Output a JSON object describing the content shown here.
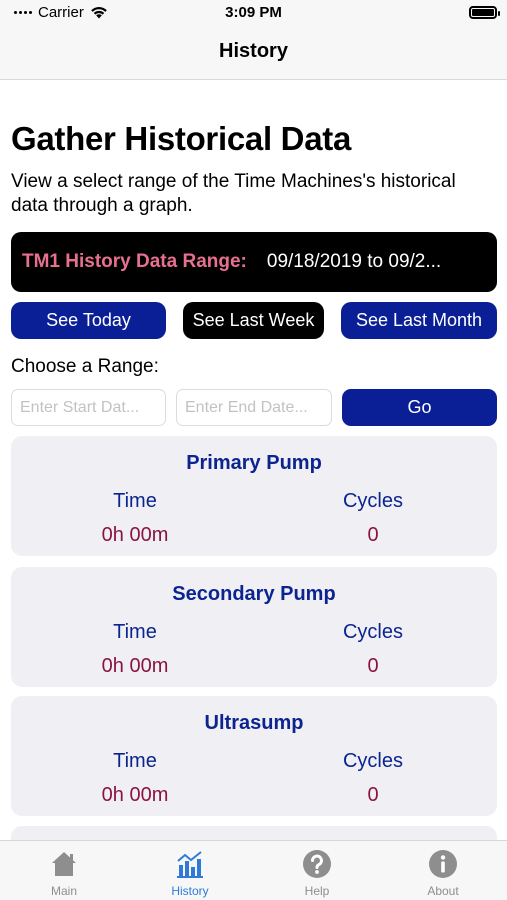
{
  "status_bar": {
    "carrier": "Carrier",
    "time": "3:09 PM"
  },
  "nav": {
    "title": "History"
  },
  "page": {
    "title": "Gather Historical Data",
    "description": "View a select range of the Time Machines's historical data through a graph."
  },
  "range_banner": {
    "label": "TM1 History Data Range:",
    "value": "09/18/2019 to 09/2..."
  },
  "quick_buttons": {
    "today": "See Today",
    "last_week": "See Last Week",
    "last_month": "See Last Month"
  },
  "choose_range": {
    "label": "Choose a Range:",
    "start_placeholder": "Enter Start Dat...",
    "end_placeholder": "Enter End Date...",
    "go_label": "Go"
  },
  "cards": [
    {
      "title": "Primary Pump",
      "time_label": "Time",
      "cycles_label": "Cycles",
      "time_value": "0h 00m",
      "cycles_value": "0"
    },
    {
      "title": "Secondary Pump",
      "time_label": "Time",
      "cycles_label": "Cycles",
      "time_value": "0h 00m",
      "cycles_value": "0"
    },
    {
      "title": "Ultrasump",
      "time_label": "Time",
      "cycles_label": "Cycles",
      "time_value": "0h 00m",
      "cycles_value": "0"
    }
  ],
  "tabs": [
    {
      "label": "Main",
      "icon": "house-icon",
      "active": false
    },
    {
      "label": "History",
      "icon": "bar-chart-icon",
      "active": true
    },
    {
      "label": "Help",
      "icon": "question-icon",
      "active": false
    },
    {
      "label": "About",
      "icon": "info-icon",
      "active": false
    }
  ],
  "colors": {
    "accent_blue": "#0a1f96",
    "card_title_blue": "#0c2490",
    "value_maroon": "#8a1441",
    "banner_pink": "#e8708f",
    "tab_active": "#2f7ad8",
    "tab_inactive": "#8e8e8e"
  }
}
